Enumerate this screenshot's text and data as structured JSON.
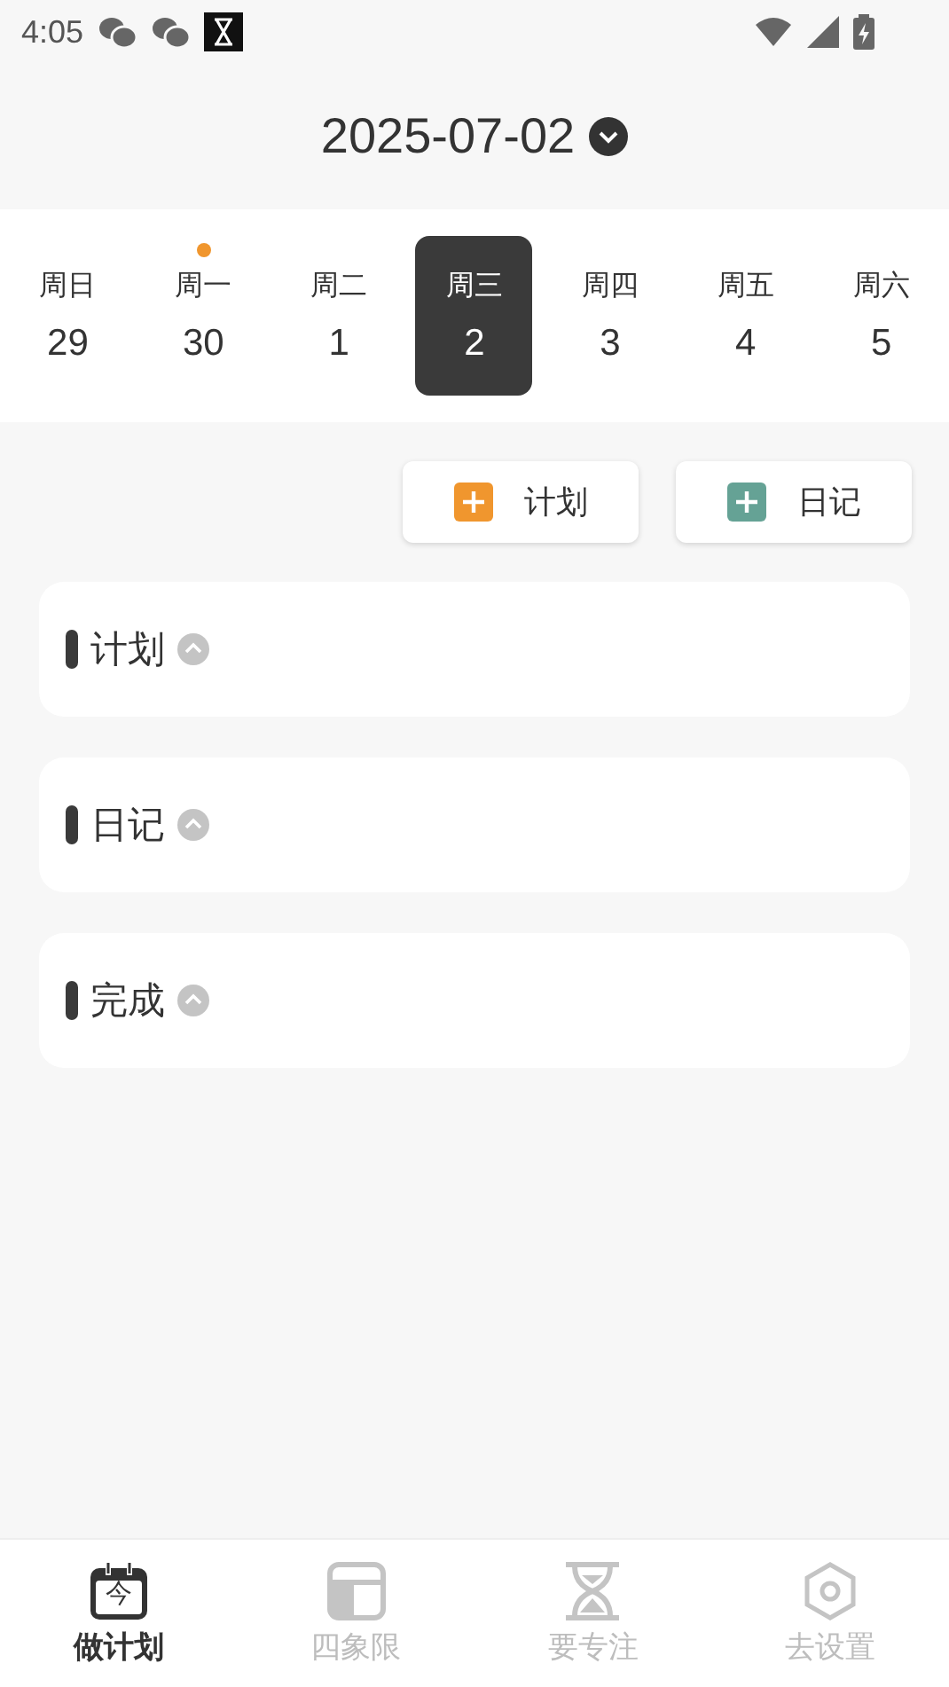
{
  "status_bar": {
    "time": "4:05"
  },
  "header": {
    "date": "2025-07-02"
  },
  "week": [
    {
      "weekday": "周日",
      "day": "29",
      "selected": false,
      "marked": false
    },
    {
      "weekday": "周一",
      "day": "30",
      "selected": false,
      "marked": true
    },
    {
      "weekday": "周二",
      "day": "1",
      "selected": false,
      "marked": false
    },
    {
      "weekday": "周三",
      "day": "2",
      "selected": true,
      "marked": false
    },
    {
      "weekday": "周四",
      "day": "3",
      "selected": false,
      "marked": false
    },
    {
      "weekday": "周五",
      "day": "4",
      "selected": false,
      "marked": false
    },
    {
      "weekday": "周六",
      "day": "5",
      "selected": false,
      "marked": false
    }
  ],
  "add_buttons": [
    {
      "label": "计划",
      "color": "#f0962e"
    },
    {
      "label": "日记",
      "color": "#65a295"
    }
  ],
  "sections": [
    {
      "title": "计划",
      "expanded": true
    },
    {
      "title": "日记",
      "expanded": true
    },
    {
      "title": "完成",
      "expanded": true
    }
  ],
  "tab_bar": [
    {
      "label": "做计划",
      "kind": "calendar",
      "icon_text": "今",
      "selected": true
    },
    {
      "label": "四象限",
      "kind": "quadrant",
      "selected": false
    },
    {
      "label": "要专注",
      "kind": "hourglass",
      "selected": false
    },
    {
      "label": "去设置",
      "kind": "settings",
      "selected": false
    }
  ]
}
